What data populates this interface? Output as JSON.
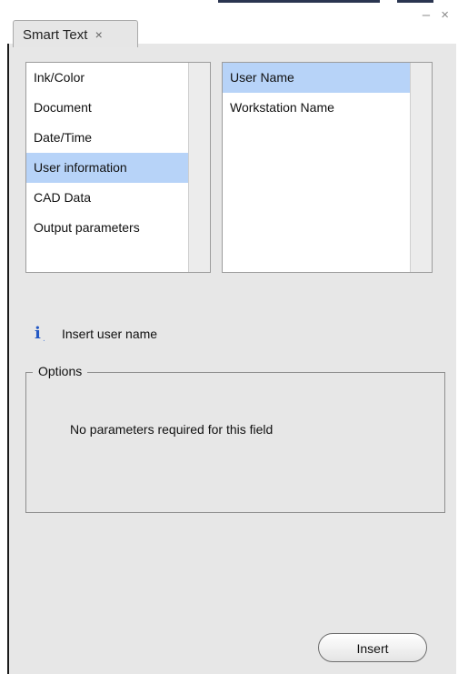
{
  "window": {
    "controls": "– ×"
  },
  "tab": {
    "label": "Smart Text",
    "close_glyph": "×"
  },
  "categories": {
    "items": [
      {
        "label": "Ink/Color",
        "selected": false
      },
      {
        "label": "Document",
        "selected": false
      },
      {
        "label": "Date/Time",
        "selected": false
      },
      {
        "label": "User information",
        "selected": true
      },
      {
        "label": "CAD Data",
        "selected": false
      },
      {
        "label": "Output parameters",
        "selected": false
      }
    ]
  },
  "fields": {
    "items": [
      {
        "label": "User Name",
        "selected": true
      },
      {
        "label": "Workstation Name",
        "selected": false
      }
    ]
  },
  "info": {
    "icon": "info-icon",
    "text": "Insert user name"
  },
  "options": {
    "legend": "Options",
    "message": "No parameters required for this field"
  },
  "actions": {
    "insert_label": "Insert"
  },
  "colors": {
    "panel_background": "#e7e7e7",
    "selection": "#b7d3f8",
    "info_icon": "#2358c4"
  }
}
